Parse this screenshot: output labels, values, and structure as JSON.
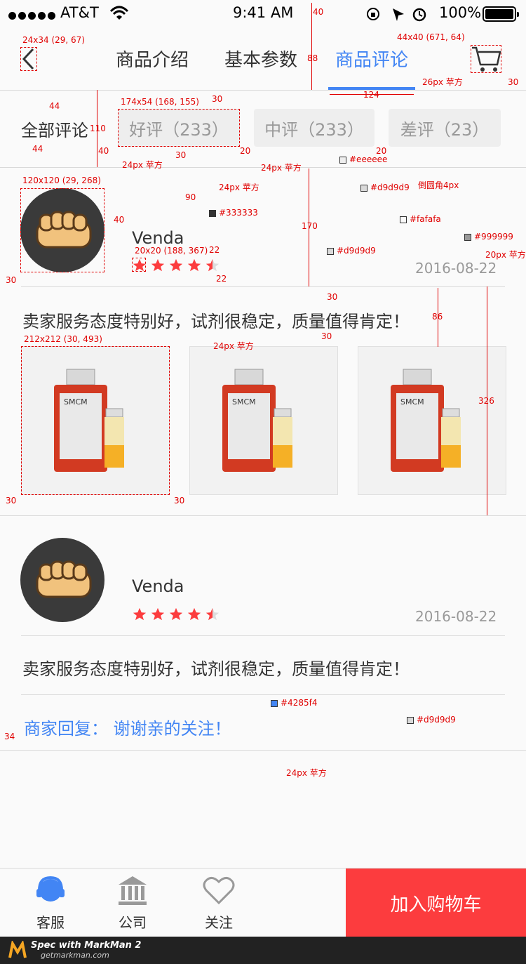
{
  "status_bar": {
    "carrier": "AT&T",
    "time": "9:41 AM",
    "battery": "100%"
  },
  "nav": {
    "tabs": [
      "商品介绍",
      "基本参数",
      "商品评论"
    ],
    "active_tab_index": 2
  },
  "filters": {
    "all": "全部评论",
    "good": "好评（233）",
    "medium": "中评（233）",
    "bad": "差评（23）"
  },
  "reviews": [
    {
      "name": "Venda",
      "rating": 4.5,
      "date": "2016-08-22",
      "text": "卖家服务态度特别好，试剂很稳定，质量值得肯定！"
    },
    {
      "name": "Venda",
      "rating": 4.5,
      "date": "2016-08-22",
      "text": "卖家服务态度特别好，试剂很稳定，质量值得肯定！",
      "reply": "商家回复：  谢谢亲的关注！"
    }
  ],
  "product_image_label": "SMCM",
  "bottom_bar": {
    "service": "客服",
    "company": "公司",
    "follow": "关注",
    "add_to_cart": "加入购物车"
  },
  "footer": {
    "spec": "Spec with MarkMan 2",
    "site": "getmarkman.com"
  },
  "colors": {
    "accent": "#4285f4",
    "star": "#fc3c3e",
    "cta": "#fc3c3e",
    "text": "#333333",
    "muted": "#999999",
    "divider": "#d9d9d9",
    "chip": "#eeeeee",
    "background": "#fafafa"
  },
  "annotations": [
    "40",
    "24x34 (29, 67)",
    "88",
    "44x40 (671, 64)",
    "26px 苹方",
    "30",
    "124",
    "174x54 (168, 155)",
    "44",
    "110",
    "40",
    "44",
    "30",
    "20",
    "20",
    "24px 苹方",
    "24px 苹方",
    "#eeeeee",
    "30",
    "120x120 (29, 268)",
    "#d9d9d9",
    "倒圆角4px",
    "24px 苹方",
    "90",
    "#333333",
    "40",
    "#fafafa",
    "170",
    "#999999",
    "20x20 (188, 367)",
    "22",
    "20px 苹方",
    "#d9d9d9",
    "30",
    "22",
    "30",
    "86",
    "24px 苹方",
    "212x212 (30, 493)",
    "30",
    "326",
    "30",
    "30",
    "#4285f4",
    "#d9d9d9",
    "34",
    "24px 苹方"
  ]
}
